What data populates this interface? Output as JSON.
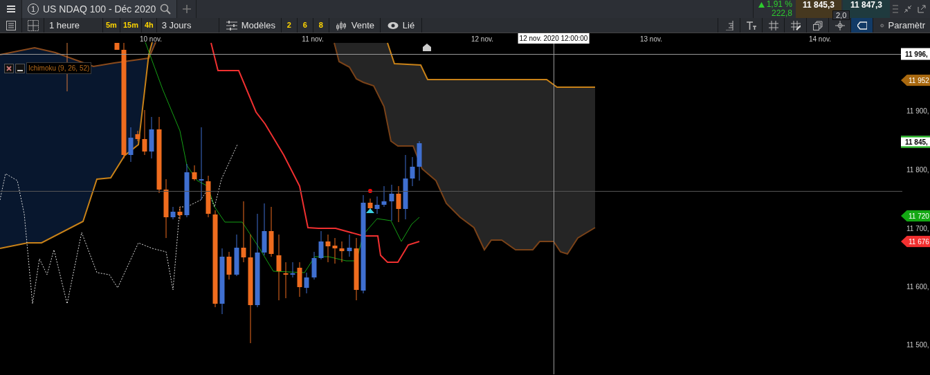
{
  "tabs": [
    {
      "number": "1",
      "title": "US NDAQ 100 - Déc 2020",
      "selected": true
    }
  ],
  "quote": {
    "change": "1,91 %",
    "change_points": "222,8",
    "bid": "11 845,3",
    "ask": "11 847,3",
    "spread": "2,0"
  },
  "toolbar": {
    "interval": "1 heure",
    "quick_intervals": [
      "5m",
      "15m",
      "4h"
    ],
    "range": "3 Jours",
    "templates": "Modèles",
    "presets": [
      "2",
      "6",
      "8"
    ],
    "chart_type": "Vente",
    "link": "Lié",
    "settings": "Paramètr"
  },
  "right_tools": [
    {
      "kind": "ruler",
      "selected": false
    },
    {
      "kind": "text",
      "selected": false
    },
    {
      "kind": "grid",
      "selected": false
    },
    {
      "kind": "griddraw",
      "selected": false
    },
    {
      "kind": "windows",
      "selected": false
    },
    {
      "kind": "crosshair",
      "selected": false
    },
    {
      "kind": "tag",
      "selected": true
    }
  ],
  "chart": {
    "date_labels": [
      "10 nov.",
      "11 nov.",
      "12 nov.",
      "13 nov.",
      "14 nov."
    ],
    "crosshair_date": "12 nov. 2020 12:00:00",
    "price_labels": [
      "11 900,",
      "11 800,",
      "11 700,",
      "11 600,",
      "11 500,"
    ],
    "price_tags": [
      {
        "text": "11 996,",
        "kind": "crosshair",
        "color": "#ffffff"
      },
      {
        "text": "11 952",
        "kind": "flag",
        "color": "#a8680f"
      },
      {
        "text": "11 845,",
        "kind": "outline",
        "color": "#13b513"
      },
      {
        "text": "11 720",
        "kind": "flag",
        "color": "#13a813"
      },
      {
        "text": "11 676",
        "kind": "flag",
        "color": "#f23030"
      }
    ],
    "indicator": {
      "label": "Ichimoku (9, 26, 52)"
    }
  }
}
